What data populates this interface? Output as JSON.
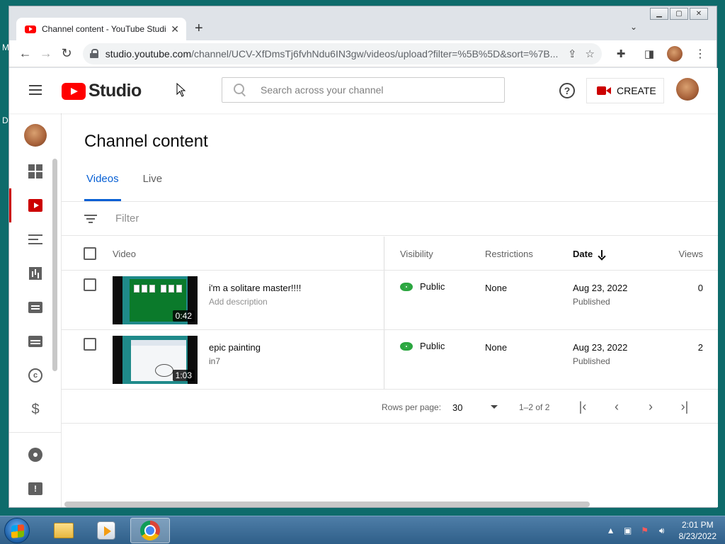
{
  "browser": {
    "tab_title": "Channel content - YouTube Studio",
    "url_host": "studio.youtube.com",
    "url_path": "/channel/UCV-XfDmsTj6fvhNdu6IN3gw/videos/upload?filter=%5B%5D&sort=%7B..."
  },
  "app": {
    "logo_text": "Studio",
    "search_placeholder": "Search across your channel",
    "create_label": "CREATE"
  },
  "page": {
    "title": "Channel content",
    "tabs": [
      {
        "label": "Videos",
        "active": true
      },
      {
        "label": "Live",
        "active": false
      }
    ],
    "filter_placeholder": "Filter"
  },
  "table": {
    "columns": {
      "video": "Video",
      "visibility": "Visibility",
      "restrictions": "Restrictions",
      "date": "Date",
      "views": "Views"
    },
    "rows": [
      {
        "title": "i'm a solitare master!!!!",
        "description": "Add description",
        "duration": "0:42",
        "visibility": "Public",
        "restrictions": "None",
        "date": "Aug 23, 2022",
        "date_status": "Published",
        "views": "0"
      },
      {
        "title": "epic painting",
        "description": "in7",
        "duration": "1:03",
        "visibility": "Public",
        "restrictions": "None",
        "date": "Aug 23, 2022",
        "date_status": "Published",
        "views": "2"
      }
    ]
  },
  "pagination": {
    "rows_per_page_label": "Rows per page:",
    "rows_per_page_value": "30",
    "range": "1–2 of 2"
  },
  "taskbar": {
    "time": "2:01 PM",
    "date": "8/23/2022"
  },
  "colors": {
    "accent_blue": "#065fd4",
    "brand_red": "#ff0000",
    "public_green": "#2ba640"
  }
}
